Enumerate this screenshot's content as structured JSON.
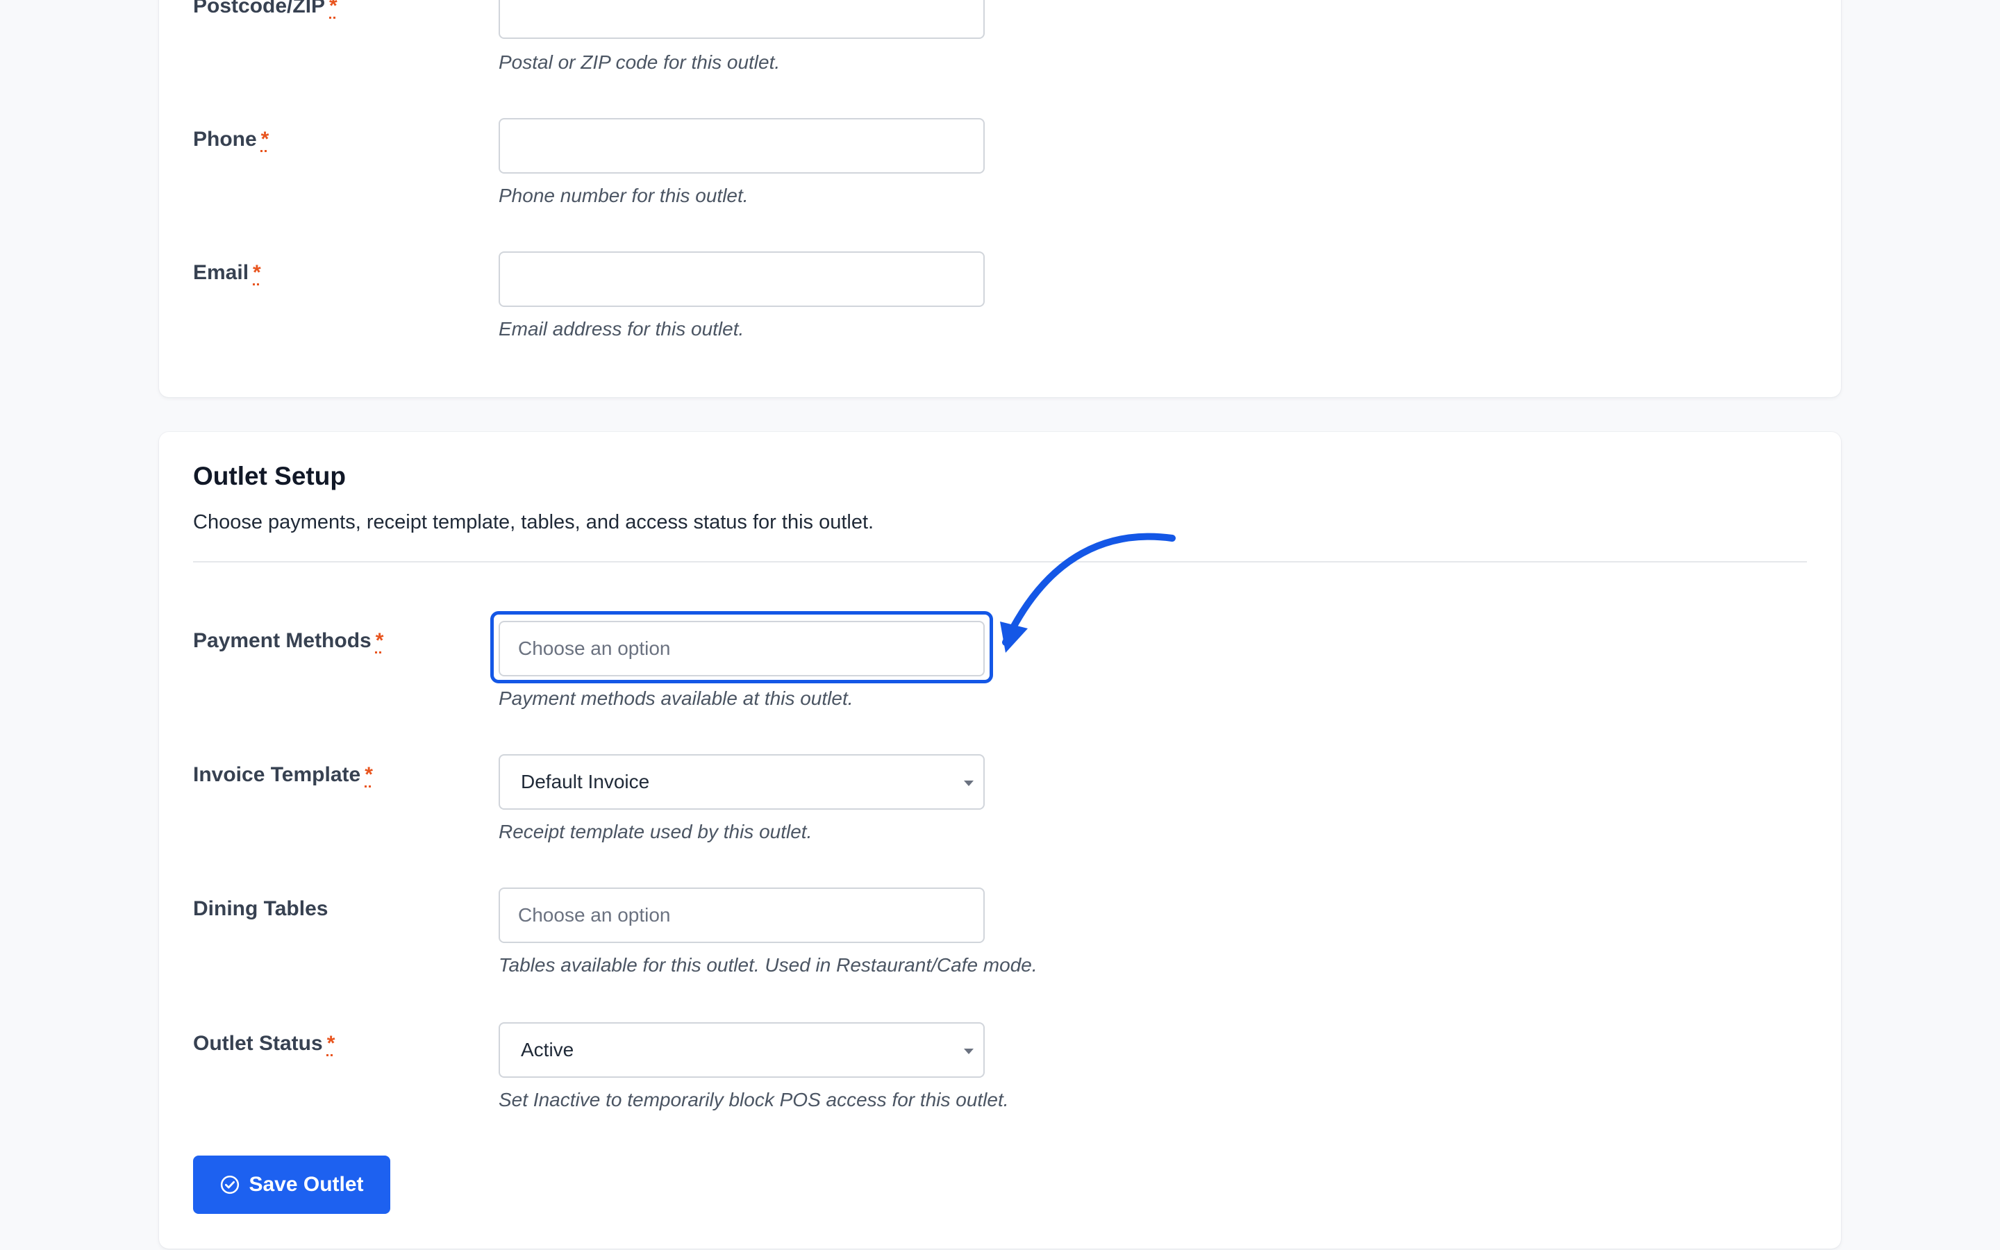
{
  "contact_fields": [
    {
      "label": "Postcode/ZIP",
      "required": "*",
      "help": "Postal or ZIP code for this outlet."
    },
    {
      "label": "Phone",
      "required": "*",
      "help": "Phone number for this outlet."
    },
    {
      "label": "Email",
      "required": "*",
      "help": "Email address for this outlet."
    }
  ],
  "outlet_setup": {
    "title": "Outlet Setup",
    "description": "Choose payments, receipt template, tables, and access status for this outlet.",
    "payment_methods": {
      "label": "Payment Methods",
      "required": "*",
      "placeholder": "Choose an option",
      "help": "Payment methods available at this outlet."
    },
    "invoice_template": {
      "label": "Invoice Template",
      "required": "*",
      "value": "Default Invoice",
      "help": "Receipt template used by this outlet."
    },
    "dining_tables": {
      "label": "Dining Tables",
      "placeholder": "Choose an option",
      "help": "Tables available for this outlet. Used in Restaurant/Cafe mode."
    },
    "outlet_status": {
      "label": "Outlet Status",
      "required": "*",
      "value": "Active",
      "help": "Set Inactive to temporarily block POS access for this outlet."
    }
  },
  "save_button": {
    "label": "Save Outlet",
    "icon": "check-circle-icon"
  },
  "colors": {
    "accent": "#1d61f0",
    "required": "#e8541e",
    "highlight": "#1457e6"
  }
}
